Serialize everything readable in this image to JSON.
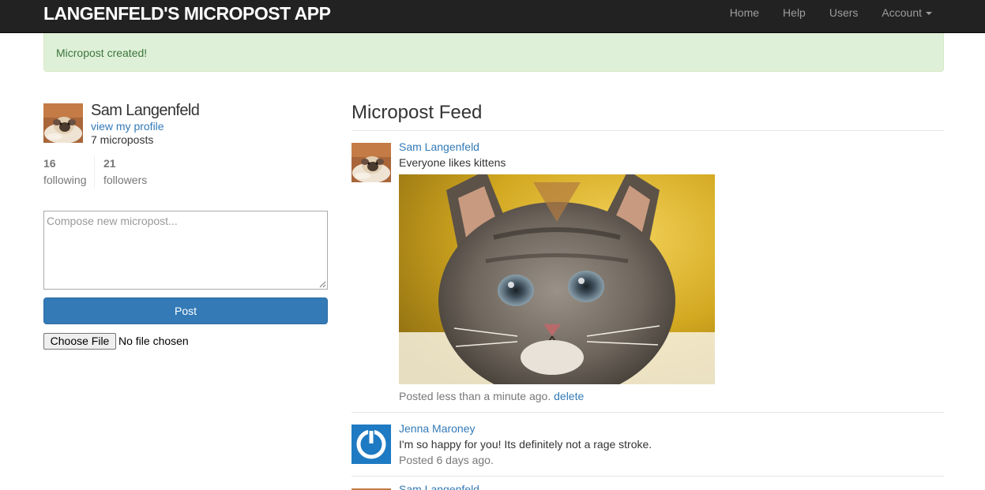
{
  "navbar": {
    "brand": "LANGENFELD'S MICROPOST APP",
    "links": [
      "Home",
      "Help",
      "Users",
      "Account"
    ]
  },
  "flash": {
    "message": "Micropost created!"
  },
  "sidebar": {
    "name": "Sam Langenfeld",
    "profile_link": "view my profile",
    "micropost_count": "7 microposts",
    "following_count": "16",
    "following_label": "following",
    "followers_count": "21",
    "followers_label": "followers"
  },
  "composer": {
    "placeholder": "Compose new micropost...",
    "post_label": "Post",
    "file_button": "Choose File",
    "file_status": "No file chosen"
  },
  "feed": {
    "title": "Micropost Feed",
    "items": [
      {
        "user": "Sam Langenfeld",
        "content": "Everyone likes kittens",
        "time": "Posted less than a minute ago.",
        "delete_label": "delete"
      },
      {
        "user": "Jenna Maroney",
        "content": "I'm so happy for you! Its definitely not a rage stroke.",
        "time": "Posted 6 days ago."
      },
      {
        "user": "Sam Langenfeld"
      }
    ]
  },
  "colors": {
    "navbar": "#222222",
    "link": "#337ab7",
    "alert_bg": "#dff0d8",
    "alert_text": "#3c763d",
    "button": "#337ab7",
    "gravatar": "#1e7ac2"
  }
}
